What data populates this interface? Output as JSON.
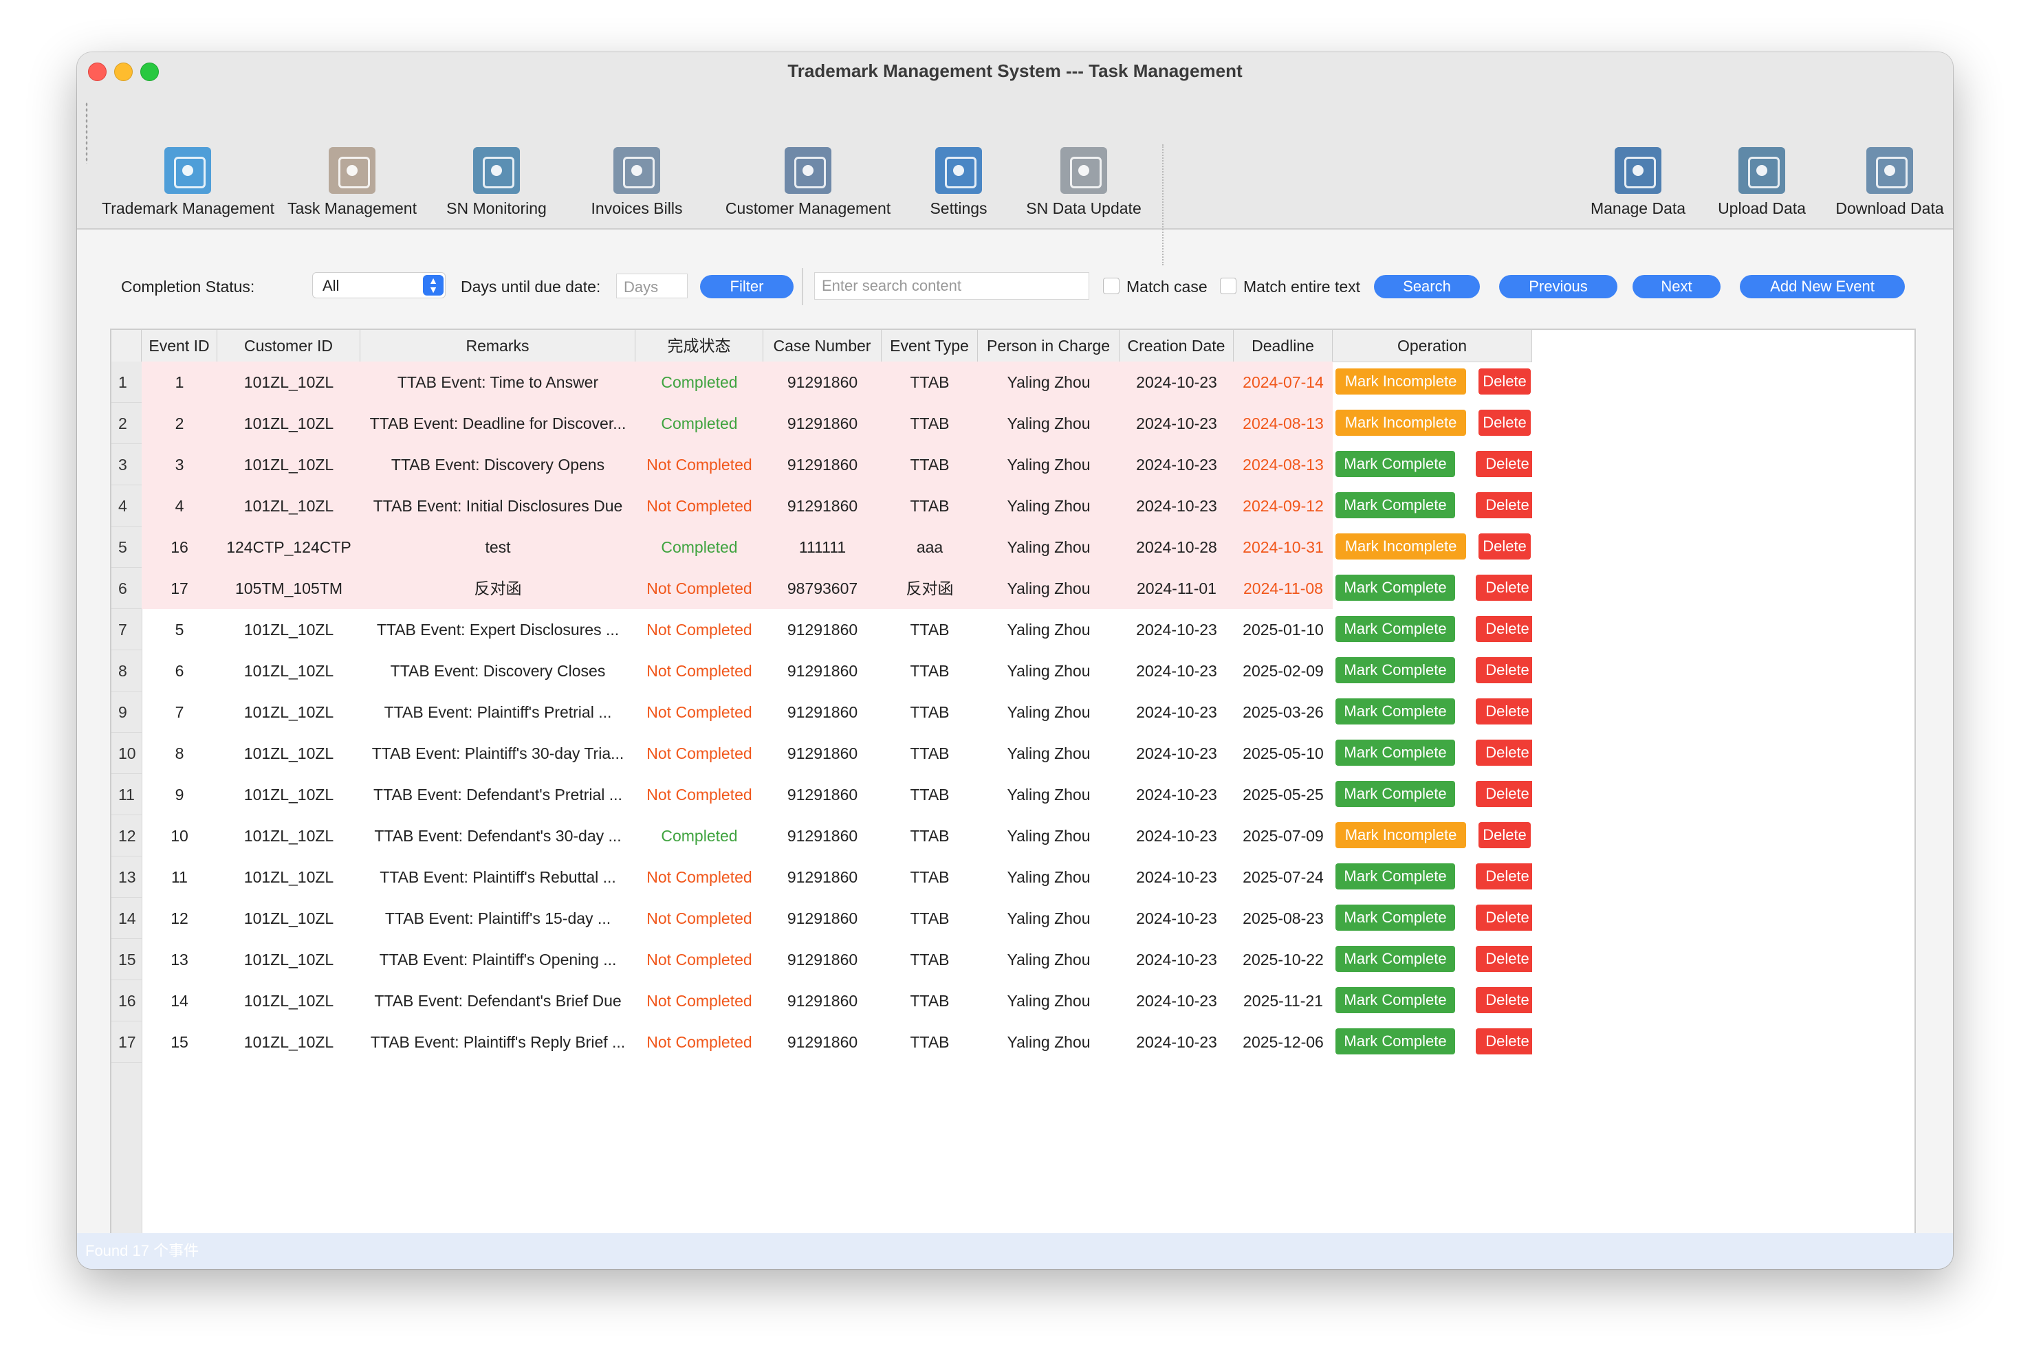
{
  "window": {
    "title": "Trademark Management System --- Task Management"
  },
  "toolbar": {
    "left_items": [
      {
        "label": "Trademark Management",
        "icon": "trademark-icon",
        "color": "#4f9ed8"
      },
      {
        "label": "Task Management",
        "icon": "task-icon",
        "color": "#b7a89a"
      },
      {
        "label": "SN Monitoring",
        "icon": "monitor-icon",
        "color": "#5b8fb3"
      },
      {
        "label": "Invoices  Bills",
        "icon": "invoice-icon",
        "color": "#7d93aa"
      },
      {
        "label": "Customer Management",
        "icon": "customer-icon",
        "color": "#6f89a8"
      },
      {
        "label": "Settings",
        "icon": "settings-icon",
        "color": "#4a86c4"
      },
      {
        "label": "SN Data Update",
        "icon": "data-update-icon",
        "color": "#9aa1a8"
      }
    ],
    "right_items": [
      {
        "label": "Manage Data",
        "icon": "manage-data-icon",
        "color": "#4f7fb1"
      },
      {
        "label": "Upload Data",
        "icon": "upload-data-icon",
        "color": "#5f89a8"
      },
      {
        "label": "Download Data",
        "icon": "download-data-icon",
        "color": "#6d8fae"
      }
    ]
  },
  "filter": {
    "completion_status_label": "Completion Status:",
    "completion_status_value": "All",
    "days_label": "Days until due date:",
    "days_placeholder": "Days",
    "filter_button": "Filter",
    "search_placeholder": "Enter search content",
    "match_case_label": "Match case",
    "match_entire_label": "Match entire text",
    "search_button": "Search",
    "previous_button": "Previous",
    "next_button": "Next",
    "add_button": "Add New Event"
  },
  "table": {
    "headers": [
      "Event ID",
      "Customer ID",
      "Remarks",
      "完成状态",
      "Case Number",
      "Event Type",
      "Person in Charge",
      "Creation Date",
      "Deadline",
      "Operation"
    ],
    "rows": [
      {
        "n": "1",
        "id": "1",
        "customer": "101ZL_10ZL",
        "remarks": "TTAB Event: Time to Answer",
        "status": "Completed",
        "case": "91291860",
        "type": "TTAB",
        "person": "Yaling Zhou",
        "created": "2024-10-23",
        "deadline": "2024-07-14",
        "overdue": true,
        "action": "Mark Incomplete",
        "delete": "Delete"
      },
      {
        "n": "2",
        "id": "2",
        "customer": "101ZL_10ZL",
        "remarks": "TTAB Event: Deadline for Discover...",
        "status": "Completed",
        "case": "91291860",
        "type": "TTAB",
        "person": "Yaling Zhou",
        "created": "2024-10-23",
        "deadline": "2024-08-13",
        "overdue": true,
        "action": "Mark Incomplete",
        "delete": "Delete"
      },
      {
        "n": "3",
        "id": "3",
        "customer": "101ZL_10ZL",
        "remarks": "TTAB Event: Discovery Opens",
        "status": "Not Completed",
        "case": "91291860",
        "type": "TTAB",
        "person": "Yaling Zhou",
        "created": "2024-10-23",
        "deadline": "2024-08-13",
        "overdue": true,
        "action": "Mark Complete",
        "delete": "Delete"
      },
      {
        "n": "4",
        "id": "4",
        "customer": "101ZL_10ZL",
        "remarks": "TTAB Event: Initial Disclosures Due",
        "status": "Not Completed",
        "case": "91291860",
        "type": "TTAB",
        "person": "Yaling Zhou",
        "created": "2024-10-23",
        "deadline": "2024-09-12",
        "overdue": true,
        "action": "Mark Complete",
        "delete": "Delete"
      },
      {
        "n": "5",
        "id": "16",
        "customer": "124CTP_124CTP",
        "remarks": "test",
        "status": "Completed",
        "case": "111111",
        "type": "aaa",
        "person": "Yaling Zhou",
        "created": "2024-10-28",
        "deadline": "2024-10-31",
        "overdue": true,
        "action": "Mark Incomplete",
        "delete": "Delete"
      },
      {
        "n": "6",
        "id": "17",
        "customer": "105TM_105TM",
        "remarks": "反对函",
        "status": "Not Completed",
        "case": "98793607",
        "type": "反对函",
        "person": "Yaling Zhou",
        "created": "2024-11-01",
        "deadline": "2024-11-08",
        "overdue": true,
        "action": "Mark Complete",
        "delete": "Delete"
      },
      {
        "n": "7",
        "id": "5",
        "customer": "101ZL_10ZL",
        "remarks": "TTAB Event: Expert Disclosures ...",
        "status": "Not Completed",
        "case": "91291860",
        "type": "TTAB",
        "person": "Yaling Zhou",
        "created": "2024-10-23",
        "deadline": "2025-01-10",
        "overdue": false,
        "action": "Mark Complete",
        "delete": "Delete"
      },
      {
        "n": "8",
        "id": "6",
        "customer": "101ZL_10ZL",
        "remarks": "TTAB Event: Discovery Closes",
        "status": "Not Completed",
        "case": "91291860",
        "type": "TTAB",
        "person": "Yaling Zhou",
        "created": "2024-10-23",
        "deadline": "2025-02-09",
        "overdue": false,
        "action": "Mark Complete",
        "delete": "Delete"
      },
      {
        "n": "9",
        "id": "7",
        "customer": "101ZL_10ZL",
        "remarks": "TTAB Event: Plaintiff's Pretrial ...",
        "status": "Not Completed",
        "case": "91291860",
        "type": "TTAB",
        "person": "Yaling Zhou",
        "created": "2024-10-23",
        "deadline": "2025-03-26",
        "overdue": false,
        "action": "Mark Complete",
        "delete": "Delete"
      },
      {
        "n": "10",
        "id": "8",
        "customer": "101ZL_10ZL",
        "remarks": "TTAB Event: Plaintiff's 30-day Tria...",
        "status": "Not Completed",
        "case": "91291860",
        "type": "TTAB",
        "person": "Yaling Zhou",
        "created": "2024-10-23",
        "deadline": "2025-05-10",
        "overdue": false,
        "action": "Mark Complete",
        "delete": "Delete"
      },
      {
        "n": "11",
        "id": "9",
        "customer": "101ZL_10ZL",
        "remarks": "TTAB Event: Defendant's Pretrial ...",
        "status": "Not Completed",
        "case": "91291860",
        "type": "TTAB",
        "person": "Yaling Zhou",
        "created": "2024-10-23",
        "deadline": "2025-05-25",
        "overdue": false,
        "action": "Mark Complete",
        "delete": "Delete"
      },
      {
        "n": "12",
        "id": "10",
        "customer": "101ZL_10ZL",
        "remarks": "TTAB Event: Defendant's 30-day ...",
        "status": "Completed",
        "case": "91291860",
        "type": "TTAB",
        "person": "Yaling Zhou",
        "created": "2024-10-23",
        "deadline": "2025-07-09",
        "overdue": false,
        "action": "Mark Incomplete",
        "delete": "Delete"
      },
      {
        "n": "13",
        "id": "11",
        "customer": "101ZL_10ZL",
        "remarks": "TTAB Event: Plaintiff's Rebuttal ...",
        "status": "Not Completed",
        "case": "91291860",
        "type": "TTAB",
        "person": "Yaling Zhou",
        "created": "2024-10-23",
        "deadline": "2025-07-24",
        "overdue": false,
        "action": "Mark Complete",
        "delete": "Delete"
      },
      {
        "n": "14",
        "id": "12",
        "customer": "101ZL_10ZL",
        "remarks": "TTAB Event: Plaintiff's 15-day ...",
        "status": "Not Completed",
        "case": "91291860",
        "type": "TTAB",
        "person": "Yaling Zhou",
        "created": "2024-10-23",
        "deadline": "2025-08-23",
        "overdue": false,
        "action": "Mark Complete",
        "delete": "Delete"
      },
      {
        "n": "15",
        "id": "13",
        "customer": "101ZL_10ZL",
        "remarks": "TTAB Event: Plaintiff's Opening ...",
        "status": "Not Completed",
        "case": "91291860",
        "type": "TTAB",
        "person": "Yaling Zhou",
        "created": "2024-10-23",
        "deadline": "2025-10-22",
        "overdue": false,
        "action": "Mark Complete",
        "delete": "Delete"
      },
      {
        "n": "16",
        "id": "14",
        "customer": "101ZL_10ZL",
        "remarks": "TTAB Event: Defendant's Brief Due",
        "status": "Not Completed",
        "case": "91291860",
        "type": "TTAB",
        "person": "Yaling Zhou",
        "created": "2024-10-23",
        "deadline": "2025-11-21",
        "overdue": false,
        "action": "Mark Complete",
        "delete": "Delete"
      },
      {
        "n": "17",
        "id": "15",
        "customer": "101ZL_10ZL",
        "remarks": "TTAB Event: Plaintiff's Reply Brief ...",
        "status": "Not Completed",
        "case": "91291860",
        "type": "TTAB",
        "person": "Yaling Zhou",
        "created": "2024-10-23",
        "deadline": "2025-12-06",
        "overdue": false,
        "action": "Mark Complete",
        "delete": "Delete"
      }
    ]
  },
  "statusbar": {
    "text": "Found 17 个事件"
  },
  "colors": {
    "accent": "#3b82f6",
    "completed": "#3fa33f",
    "not_completed": "#f1571b",
    "mark_complete": "#40a843",
    "mark_incomplete": "#f8a21b",
    "delete": "#f03d35",
    "overdue_row": "#fde8ea"
  }
}
